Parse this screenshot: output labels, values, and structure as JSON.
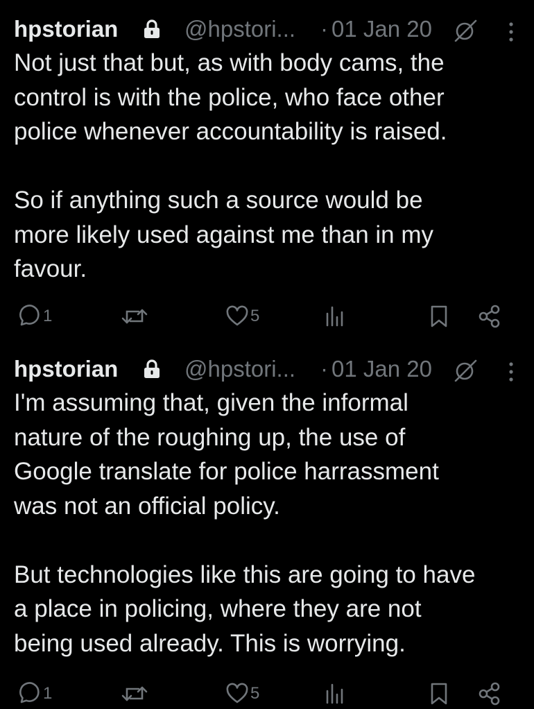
{
  "tweets": [
    {
      "display_name": "hpstorian",
      "handle": "@hpstori...",
      "separator": "·",
      "date": "01 Jan 20",
      "text": "Not just that but, as with body cams, the\ncontrol is with the police, who face other\npolice whenever accountability is raised.\n\nSo if anything such a source would be\nmore likely used against me than in my\nfavour.",
      "reply_count": "1",
      "like_count": "5"
    },
    {
      "display_name": "hpstorian",
      "handle": "@hpstori...",
      "separator": "·",
      "date": "01 Jan 20",
      "text": "I'm assuming that, given the informal\nnature of the roughing up, the use of\nGoogle translate for police harrassment\nwas not an official policy.\n\nBut technologies like this are going to have\na place in policing, where they are not\nbeing used already. This is worrying.",
      "reply_count": "1",
      "like_count": "5"
    }
  ],
  "icons": {
    "lock": "lock-icon",
    "audience": "no-sign-icon",
    "more": "more-vertical-icon",
    "reply": "reply-icon",
    "retweet": "retweet-icon",
    "like": "heart-icon",
    "views": "views-icon",
    "bookmark": "bookmark-icon",
    "share": "share-icon"
  },
  "colors": {
    "background": "#000000",
    "text": "#e7e9ea",
    "muted": "#71767b"
  }
}
